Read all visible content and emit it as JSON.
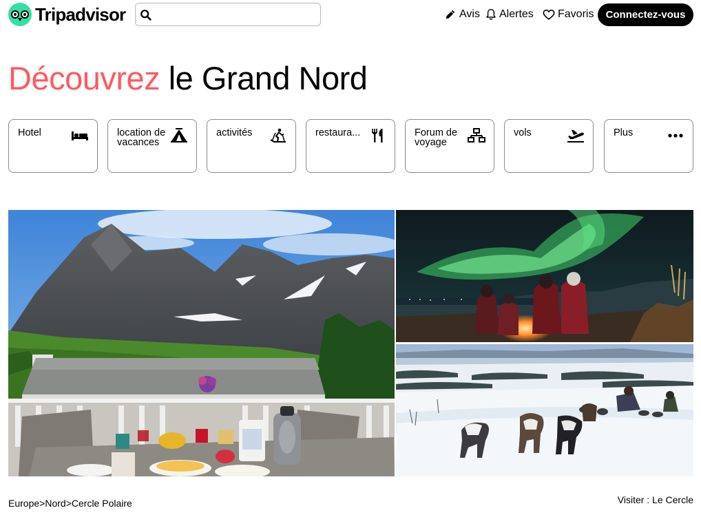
{
  "brand": {
    "name": "Tripadvisor",
    "accent_color": "#34e0a1"
  },
  "search": {
    "placeholder": "",
    "value": ""
  },
  "nav": {
    "avis": "Avis",
    "alertes": "Alertes",
    "favoris": "Favoris",
    "connect": "Connectez-vous"
  },
  "hero": {
    "title_accent": "Découvrez",
    "title_rest": " le Grand Nord",
    "accent_color": "#ff5a5f"
  },
  "categories": [
    {
      "label": "Hotel",
      "icon": "bed-icon"
    },
    {
      "label": "location de vacances",
      "icon": "tent-icon"
    },
    {
      "label": "activités",
      "icon": "skiing-icon"
    },
    {
      "label": "restaura...",
      "icon": "fork-knife-icon"
    },
    {
      "label": "Forum de voyage",
      "icon": "network-icon"
    },
    {
      "label": "vols",
      "icon": "plane-icon"
    },
    {
      "label": "Plus",
      "icon": "more-dots-icon"
    }
  ],
  "photos": [
    {
      "subject": "mountain-breakfast-terrace"
    },
    {
      "subject": "northern-lights-campfire"
    },
    {
      "subject": "husky-dog-sledding"
    }
  ],
  "breadcrumb": {
    "items": [
      "Europe",
      "Nord",
      "Cercle Polaire"
    ],
    "separator": ">"
  },
  "footer": {
    "visit": "Visiter : Le Cercle"
  }
}
